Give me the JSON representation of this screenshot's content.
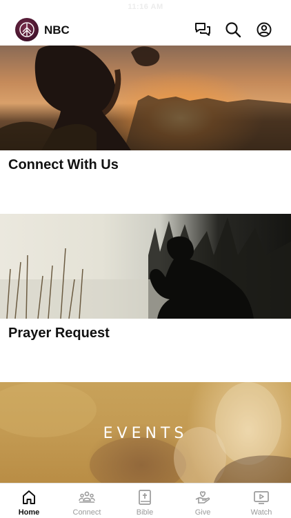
{
  "status_bar": {
    "time": "11:16 AM"
  },
  "header": {
    "app_name": "NBC"
  },
  "cards": [
    {
      "title": "Connect With Us"
    },
    {
      "title": "Prayer Request"
    },
    {
      "title": "EVENTS"
    }
  ],
  "tabs": [
    {
      "label": "Home",
      "icon": "home-icon",
      "active": true
    },
    {
      "label": "Connect",
      "icon": "people-icon"
    },
    {
      "label": "Bible",
      "icon": "bible-icon"
    },
    {
      "label": "Give",
      "icon": "give-icon"
    },
    {
      "label": "Watch",
      "icon": "watch-icon"
    }
  ]
}
